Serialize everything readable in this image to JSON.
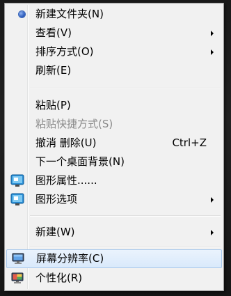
{
  "menu": {
    "items": [
      {
        "label": "新建文件夹(N)",
        "shortcut": "",
        "icon": "bullet-icon"
      },
      {
        "label": "查看(V)",
        "shortcut": "",
        "submenu": true
      },
      {
        "label": "排序方式(O)",
        "shortcut": "",
        "submenu": true
      },
      {
        "label": "刷新(E)",
        "shortcut": ""
      },
      {
        "label": "粘贴(P)",
        "shortcut": ""
      },
      {
        "label": "粘贴快捷方式(S)",
        "shortcut": "",
        "disabled": true
      },
      {
        "label": "撤消 删除(U)",
        "shortcut": "Ctrl+Z"
      },
      {
        "label": "下一个桌面背景(N)",
        "shortcut": ""
      },
      {
        "label": "图形属性......",
        "shortcut": "",
        "icon": "intel-graphics-icon"
      },
      {
        "label": "图形选项",
        "shortcut": "",
        "submenu": true,
        "icon": "intel-graphics-icon"
      },
      {
        "label": "新建(W)",
        "shortcut": "",
        "submenu": true
      },
      {
        "label": "屏幕分辨率(C)",
        "shortcut": "",
        "icon": "screen-resolution-icon",
        "highlighted": true
      },
      {
        "label": "个性化(R)",
        "shortcut": "",
        "icon": "personalize-icon"
      }
    ]
  },
  "colors": {
    "menu_bg": "#f1f1f1",
    "highlight_bg": "#dceafb",
    "highlight_border": "#a8c8ec",
    "disabled_text": "#8a8a8a"
  }
}
